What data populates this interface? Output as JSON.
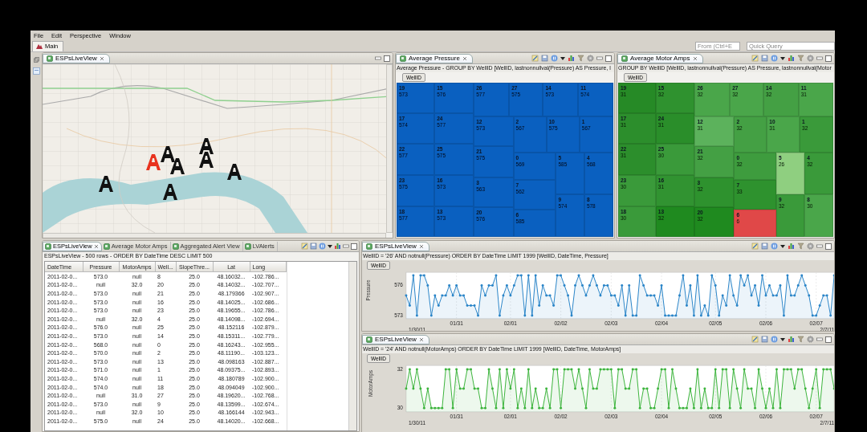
{
  "menu": [
    "File",
    "Edit",
    "Perspective",
    "Window"
  ],
  "perspective_tab": {
    "label": "Main",
    "selected": true
  },
  "search": [
    {
      "placeholder": "From (Ctrl+E"
    },
    {
      "placeholder": "Quick Query"
    }
  ],
  "map_view": {
    "tab": {
      "label": "ESPsLiveView",
      "selected": true
    },
    "markers": [
      {
        "color": "#e8321e"
      },
      {
        "color": "#111111"
      },
      {
        "color": "#111111"
      },
      {
        "color": "#111111"
      },
      {
        "color": "#111111"
      },
      {
        "color": "#111111"
      },
      {
        "color": "#111111"
      },
      {
        "color": "#111111"
      }
    ]
  },
  "pressure_view": {
    "tab": {
      "label": "Average Pressure",
      "selected": true
    },
    "query": "Average Pressure - GROUP BY WellID [WellID, lastnonnullval(Pressure) AS Pressure, l",
    "group_button": "WellID",
    "cells": [
      {
        "label": "19",
        "value": "573"
      },
      {
        "label": "17",
        "value": "574"
      },
      {
        "label": "22",
        "value": "577"
      },
      {
        "label": "23",
        "value": "575"
      },
      {
        "label": "18",
        "value": "577"
      },
      {
        "label": "15",
        "value": "576"
      },
      {
        "label": "24",
        "value": "577"
      },
      {
        "label": "25",
        "value": "575"
      },
      {
        "label": "16",
        "value": "573"
      },
      {
        "label": "13",
        "value": "573"
      },
      {
        "label": "26",
        "value": "577"
      },
      {
        "label": "27",
        "value": "575"
      },
      {
        "label": "14",
        "value": "573"
      },
      {
        "label": "11",
        "value": "574"
      },
      {
        "label": "12",
        "value": "573"
      },
      {
        "label": "21",
        "value": "575"
      },
      {
        "label": "3",
        "value": "563"
      },
      {
        "label": "20",
        "value": "576"
      },
      {
        "label": "2",
        "value": "567"
      },
      {
        "label": "10",
        "value": "575"
      },
      {
        "label": "1",
        "value": "567"
      },
      {
        "label": "0",
        "value": "569"
      },
      {
        "label": "7",
        "value": "562"
      },
      {
        "label": "6",
        "value": "585"
      },
      {
        "label": "5",
        "value": "585"
      },
      {
        "label": "9",
        "value": "574"
      },
      {
        "label": "4",
        "value": "568"
      },
      {
        "label": "8",
        "value": "578"
      }
    ]
  },
  "motor_view": {
    "tab": {
      "label": "Average Motor Amps",
      "selected": true
    },
    "query": "GROUP BY WellID [WellID, lastnonnullval(Pressure) AS Pressure, lastnonnullval(Motor",
    "group_button": "WellID",
    "cells": [
      {
        "label": "19",
        "value": "31",
        "color": "#268a26"
      },
      {
        "label": "17",
        "value": "31",
        "color": "#2c8e2c"
      },
      {
        "label": "22",
        "value": "31",
        "color": "#2c8e2c"
      },
      {
        "label": "23",
        "value": "30",
        "color": "#3a9a3a"
      },
      {
        "label": "18",
        "value": "30",
        "color": "#3a9a3a"
      },
      {
        "label": "15",
        "value": "32",
        "color": "#2f922f"
      },
      {
        "label": "24",
        "value": "31",
        "color": "#2a8e2a"
      },
      {
        "label": "25",
        "value": "30",
        "color": "#3a9a3a"
      },
      {
        "label": "16",
        "value": "31",
        "color": "#319331"
      },
      {
        "label": "13",
        "value": "32",
        "color": "#1f8a1f"
      },
      {
        "label": "26",
        "value": "32",
        "color": "#4aa64a"
      },
      {
        "label": "27",
        "value": "32",
        "color": "#4aa64a"
      },
      {
        "label": "14",
        "value": "32",
        "color": "#44a044"
      },
      {
        "label": "11",
        "value": "31",
        "color": "#4aa64a"
      },
      {
        "label": "12",
        "value": "31",
        "color": "#5cb25c"
      },
      {
        "label": "21",
        "value": "32",
        "color": "#44a044"
      },
      {
        "label": "3",
        "value": "32",
        "color": "#2e922e"
      },
      {
        "label": "20",
        "value": "32",
        "color": "#1f8a1f"
      },
      {
        "label": "2",
        "value": "32",
        "color": "#44a044"
      },
      {
        "label": "10",
        "value": "31",
        "color": "#4aa64a"
      },
      {
        "label": "1",
        "value": "32",
        "color": "#3a9a3a"
      },
      {
        "label": "0",
        "value": "32",
        "color": "#3e9c3e"
      },
      {
        "label": "7",
        "value": "33",
        "color": "#2e922e"
      },
      {
        "label": "6",
        "value": "6",
        "color": "#e04848"
      },
      {
        "label": "5",
        "value": "26",
        "color": "#8fcf80"
      },
      {
        "label": "9",
        "value": "32",
        "color": "#3a9a3a"
      },
      {
        "label": "4",
        "value": "32",
        "color": "#3a9a3a"
      },
      {
        "label": "8",
        "value": "30",
        "color": "#4aa64a"
      }
    ]
  },
  "table_view": {
    "tabs": [
      {
        "label": "ESPsLiveView",
        "selected": true
      },
      {
        "label": "Average Motor Amps",
        "selected": false
      },
      {
        "label": "Aggregated Alert View",
        "selected": false
      },
      {
        "label": "LVAlerts",
        "selected": false
      }
    ],
    "caption": "ESPsLiveView - 500 rows - ORDER BY DateTime DESC LIMIT 500",
    "columns": [
      "DateTime",
      "Pressure",
      "MotorAmps",
      "Well...",
      "SlopeThre...",
      "Lat",
      "Long"
    ],
    "rows": [
      [
        "2011-02-0...",
        "573.0",
        "null",
        "8",
        "25.0",
        "48.16032...",
        "-102.786..."
      ],
      [
        "2011-02-0...",
        "null",
        "32.0",
        "20",
        "25.0",
        "48.14032...",
        "-102.707..."
      ],
      [
        "2011-02-0...",
        "573.0",
        "null",
        "21",
        "25.0",
        "48.179366",
        "-102.907..."
      ],
      [
        "2011-02-0...",
        "573.0",
        "null",
        "16",
        "25.0",
        "48.14025...",
        "-102.686..."
      ],
      [
        "2011-02-0...",
        "573.0",
        "null",
        "23",
        "25.0",
        "48.19655...",
        "-102.786..."
      ],
      [
        "2011-02-0...",
        "null",
        "32.0",
        "4",
        "25.0",
        "48.14098...",
        "-102.694..."
      ],
      [
        "2011-02-0...",
        "576.0",
        "null",
        "25",
        "25.0",
        "48.152116",
        "-102.879..."
      ],
      [
        "2011-02-0...",
        "573.0",
        "null",
        "14",
        "25.0",
        "48.15311...",
        "-102.779..."
      ],
      [
        "2011-02-0...",
        "568.0",
        "null",
        "0",
        "25.0",
        "48.16243...",
        "-102.955..."
      ],
      [
        "2011-02-0...",
        "570.0",
        "null",
        "2",
        "25.0",
        "48.11190...",
        "-103.123..."
      ],
      [
        "2011-02-0...",
        "573.0",
        "null",
        "13",
        "25.0",
        "48.098163",
        "-102.887..."
      ],
      [
        "2011-02-0...",
        "571.0",
        "null",
        "1",
        "25.0",
        "48.09375...",
        "-102.893..."
      ],
      [
        "2011-02-0...",
        "574.0",
        "null",
        "11",
        "25.0",
        "48.180789",
        "-102.900..."
      ],
      [
        "2011-02-0...",
        "574.0",
        "null",
        "18",
        "25.0",
        "48.094049",
        "-102.900..."
      ],
      [
        "2011-02-0...",
        "null",
        "31.0",
        "27",
        "25.0",
        "48.19620...",
        "-102.768..."
      ],
      [
        "2011-02-0...",
        "573.0",
        "null",
        "9",
        "25.0",
        "48.13599...",
        "-102.674..."
      ],
      [
        "2011-02-0...",
        "null",
        "32.0",
        "10",
        "25.0",
        "48.166144",
        "-102.943..."
      ],
      [
        "2011-02-0...",
        "575.0",
        "null",
        "24",
        "25.0",
        "48.14020...",
        "-102.668..."
      ]
    ]
  },
  "pressure_chart": {
    "tab": {
      "label": "ESPsLiveView",
      "selected": true
    },
    "query": "WellID = '26' AND notnull(Pressure) ORDER BY DateTime LIMIT 1999 [WellID, DateTime, Pressure]",
    "group_button": "WellID",
    "chart_data": {
      "type": "area",
      "grid": true,
      "categories": [
        null,
        null,
        null,
        null,
        null,
        null,
        null,
        null,
        null,
        null,
        null,
        null,
        null,
        null,
        "01/31",
        null,
        null,
        null,
        null,
        null,
        null,
        null,
        null,
        null,
        null,
        null,
        null,
        null,
        null,
        "02/01",
        null,
        null,
        null,
        null,
        null,
        null,
        null,
        null,
        null,
        null,
        null,
        null,
        null,
        "02/02",
        null,
        null,
        null,
        null,
        null,
        null,
        null,
        null,
        null,
        null,
        null,
        null,
        null,
        "02/03",
        null,
        null,
        null,
        null,
        null,
        null,
        null,
        null,
        null,
        null,
        null,
        null,
        null,
        "02/04",
        null,
        null,
        null,
        null,
        null,
        null,
        null,
        null,
        null,
        null,
        null,
        null,
        null,
        null,
        "02/05",
        null,
        null,
        null,
        null,
        null,
        null,
        null,
        null,
        null,
        null,
        null,
        null,
        null,
        "02/06",
        null,
        null,
        null,
        null,
        null,
        null,
        null,
        null,
        null,
        null,
        null,
        null,
        null,
        "02/07",
        null,
        null,
        null,
        null,
        null
      ],
      "ylim": [
        572.7,
        577.3
      ],
      "yticks": [
        573,
        576
      ],
      "annotations": [
        {
          "text": "1/30/11"
        },
        {
          "text": "2/7/11"
        }
      ],
      "series": [
        {
          "name": "Pressure",
          "color": "#2a85c8",
          "values": [
            575,
            574,
            577,
            573,
            577,
            577,
            576,
            573,
            575,
            574,
            575,
            575,
            576,
            575,
            576,
            575,
            575,
            574,
            574,
            574,
            573,
            576,
            575,
            576,
            576,
            577,
            573,
            575,
            576,
            575,
            576,
            577,
            577,
            573,
            577,
            573,
            577,
            574,
            576,
            575,
            575,
            574,
            577,
            577,
            576,
            575,
            573,
            576,
            577,
            576,
            575,
            576,
            577,
            576,
            575,
            576,
            576,
            575,
            575,
            574,
            576,
            573,
            576,
            573,
            573,
            577,
            576,
            575,
            575,
            575,
            574,
            576,
            573,
            573,
            573,
            573,
            575,
            577,
            574,
            576,
            573,
            577,
            573,
            574,
            573,
            577,
            576,
            573,
            575,
            574,
            577,
            575,
            574,
            577,
            576,
            577,
            575,
            576,
            574,
            577,
            575,
            576,
            575,
            575,
            576,
            573,
            577,
            575,
            575,
            576,
            577,
            576,
            575,
            573,
            573,
            574,
            575,
            575,
            573,
            577
          ]
        }
      ]
    }
  },
  "motor_chart": {
    "tab": {
      "label": "ESPsLiveView",
      "selected": true
    },
    "query": "WellID = '24' AND notnull(MotorAmps) ORDER BY DateTime LIMIT 1999 [WellID, DateTime, MotorAmps]",
    "group_button": "WellID",
    "chart_data": {
      "type": "area",
      "grid": true,
      "categories": [
        null,
        null,
        null,
        null,
        null,
        null,
        null,
        null,
        null,
        null,
        null,
        null,
        null,
        null,
        "01/31",
        null,
        null,
        null,
        null,
        null,
        null,
        null,
        null,
        null,
        null,
        null,
        null,
        null,
        null,
        "02/01",
        null,
        null,
        null,
        null,
        null,
        null,
        null,
        null,
        null,
        null,
        null,
        null,
        null,
        "02/02",
        null,
        null,
        null,
        null,
        null,
        null,
        null,
        null,
        null,
        null,
        null,
        null,
        null,
        "02/03",
        null,
        null,
        null,
        null,
        null,
        null,
        null,
        null,
        null,
        null,
        null,
        null,
        null,
        "02/04",
        null,
        null,
        null,
        null,
        null,
        null,
        null,
        null,
        null,
        null,
        null,
        null,
        null,
        null,
        "02/05",
        null,
        null,
        null,
        null,
        null,
        null,
        null,
        null,
        null,
        null,
        null,
        null,
        null,
        "02/06",
        null,
        null,
        null,
        null,
        null,
        null,
        null,
        null,
        null,
        null,
        null,
        null,
        null,
        "02/07",
        null,
        null,
        null,
        null,
        null
      ],
      "ylim": [
        29.8,
        32.2
      ],
      "yticks": [
        30,
        32
      ],
      "annotations": [
        {
          "text": "1/30/11"
        },
        {
          "text": "2/7/11"
        }
      ],
      "series": [
        {
          "name": "MotorAmps",
          "color": "#3cb43c",
          "values": [
            31,
            32,
            31,
            32,
            31,
            30,
            31,
            30,
            30,
            30,
            30,
            32,
            32,
            30,
            32,
            31,
            31,
            32,
            32,
            31,
            31,
            30,
            30,
            32,
            31,
            30,
            32,
            30,
            32,
            31,
            32,
            30,
            31,
            30,
            32,
            30,
            31,
            30,
            30,
            31,
            30,
            32,
            32,
            30,
            32,
            32,
            32,
            31,
            32,
            31,
            30,
            32,
            31,
            31,
            32,
            32,
            32,
            32,
            30,
            32,
            32,
            31,
            31,
            32,
            32,
            30,
            31,
            31,
            30,
            30,
            31,
            32,
            32,
            30,
            32,
            31,
            30,
            30,
            30,
            31,
            30,
            32,
            30,
            31,
            30,
            30,
            32,
            30,
            32,
            32,
            30,
            32,
            31,
            30,
            32,
            31,
            31,
            30,
            32,
            31,
            30,
            31,
            30,
            32,
            30,
            32,
            32,
            32,
            31,
            32,
            32,
            31,
            30,
            31,
            32,
            30,
            32,
            32,
            32,
            31
          ]
        }
      ]
    }
  }
}
